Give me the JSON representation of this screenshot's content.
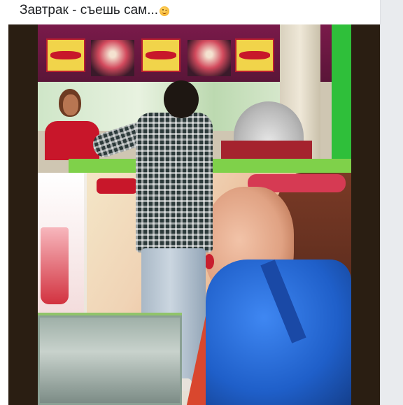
{
  "post": {
    "text": "Завтрак - съешь сам...",
    "emoji": "winking-face"
  },
  "photo": {
    "description_colors": {
      "frame": "#2a1e12",
      "counter_green": "#7fd14a",
      "banner": "#7a1a4a",
      "backpack_blue": "#1f5fc9"
    }
  }
}
